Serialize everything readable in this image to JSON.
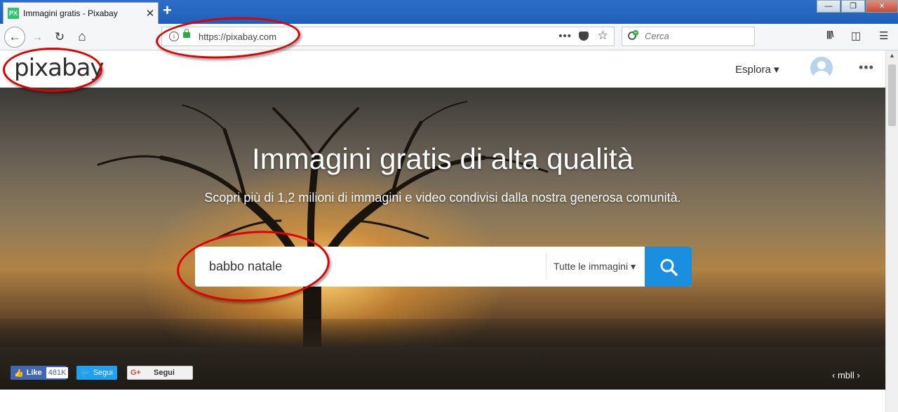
{
  "browser": {
    "tab_title": "Immagini gratis - Pixabay",
    "tab_favicon_text": "PX",
    "tab_close_glyph": "✕",
    "new_tab_glyph": "+",
    "window_controls": {
      "minimize": "—",
      "maximize": "❐",
      "close": "✕"
    },
    "url": "https://pixabay.com",
    "search_placeholder": "Cerca",
    "page_actions_glyph": "•••",
    "bookmark_glyph": "☆",
    "nav_glyphs": {
      "back": "←",
      "forward": "→",
      "reload": "↻",
      "home": "⌂"
    },
    "toolbar_glyphs": {
      "library": "|||\\",
      "sidebar": "◫",
      "menu": "☰"
    }
  },
  "site": {
    "logo": "pixabay",
    "explore_label": "Esplora ▾",
    "more_glyph": "•••"
  },
  "hero": {
    "title": "Immagini gratis di alta qualità",
    "subtitle": "Scopri più di 1,2 milioni di immagini e video condivisi dalla nostra generosa comunità.",
    "search_value": "babbo natale",
    "search_type": "Tutte le immagini ▾",
    "photo_credit": "‹  mbll  ›"
  },
  "social": {
    "facebook_label": "Like",
    "facebook_count": "481K",
    "twitter_label": "Segui",
    "google_label": "Segui",
    "google_icon": "G+"
  },
  "colors": {
    "accent": "#1a8fe0",
    "annotation": "#e00000",
    "favicon": "#2ec66d"
  }
}
